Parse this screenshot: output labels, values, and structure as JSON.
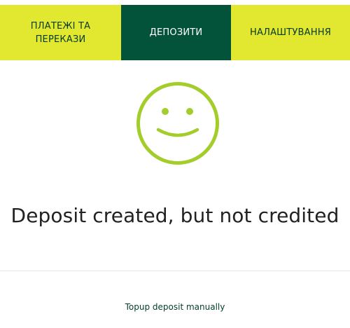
{
  "nav": {
    "tabs": [
      {
        "label_line1": "ПЛАТЕЖІ ТА",
        "label_line2": "ПЕРЕКАЗИ",
        "active": false
      },
      {
        "label": "ДЕПОЗИТИ",
        "active": true
      },
      {
        "label": "НАЛАШТУВАННЯ",
        "active": false
      }
    ]
  },
  "status": {
    "icon": "smiley-icon",
    "title": "Deposit created, but not credited"
  },
  "actions": {
    "topup_label": "Topup deposit manually"
  },
  "colors": {
    "accent": "#e1e82f",
    "active_tab": "#03533a",
    "smiley": "#a2cd2a",
    "text_dark": "#222222"
  }
}
